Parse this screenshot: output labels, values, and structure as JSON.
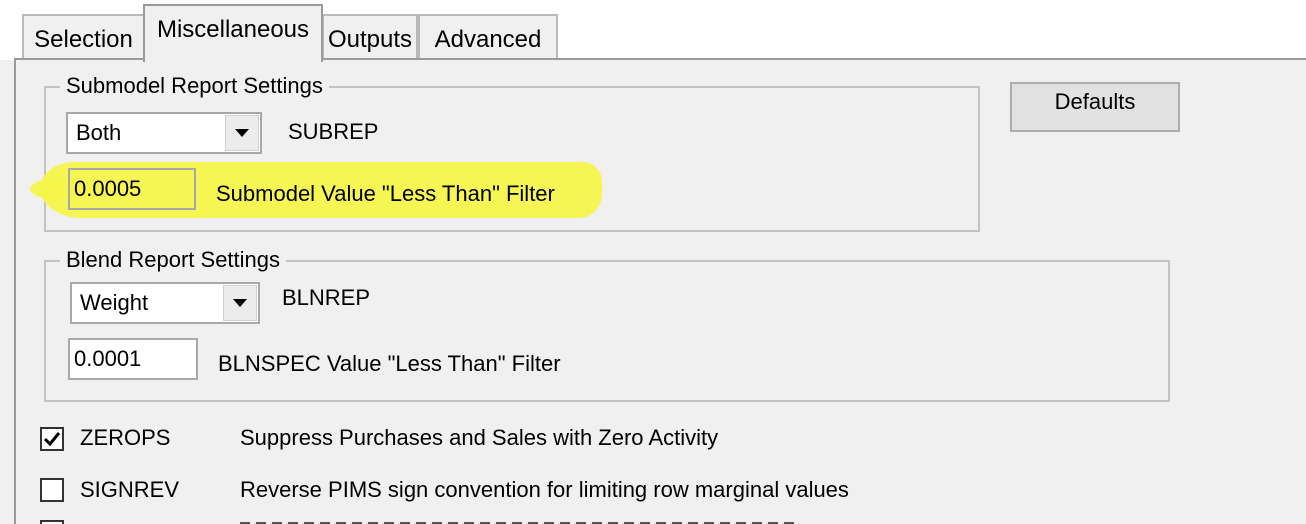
{
  "tabs": [
    {
      "label": "Selection",
      "active": false
    },
    {
      "label": "Miscellaneous",
      "active": true
    },
    {
      "label": "Outputs",
      "active": false
    },
    {
      "label": "Advanced",
      "active": false
    }
  ],
  "submodel_group": {
    "title": "Submodel Report Settings",
    "report_combo": {
      "selected": "Both",
      "icon": "chevron-down-icon"
    },
    "report_label": "SUBREP",
    "filter_value": "0.0005",
    "filter_label": "Submodel Value \"Less Than\" Filter",
    "highlight_color": "#f4f44a"
  },
  "blend_group": {
    "title": "Blend Report Settings",
    "report_combo": {
      "selected": "Weight",
      "icon": "chevron-down-icon"
    },
    "report_label": "BLNREP",
    "filter_value": "0.0001",
    "filter_label": "BLNSPEC Value \"Less Than\" Filter"
  },
  "defaults_button": {
    "label": "Defaults"
  },
  "options": [
    {
      "name": "ZEROPS",
      "checked": true,
      "description": "Suppress Purchases and Sales with Zero Activity"
    },
    {
      "name": "SIGNREV",
      "checked": false,
      "description": "Reverse PIMS sign convention for limiting row marginal values"
    }
  ]
}
